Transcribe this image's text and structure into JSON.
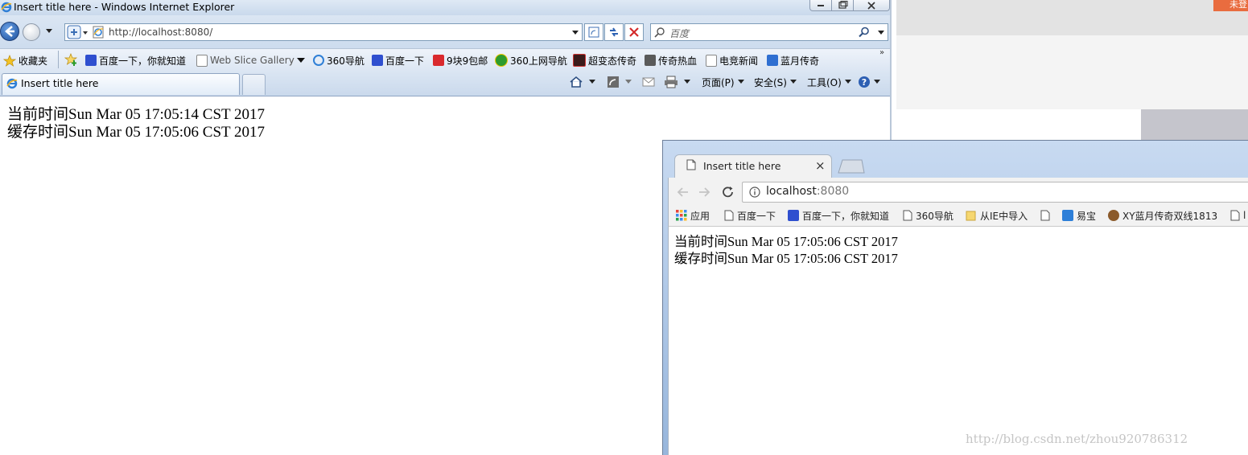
{
  "background": {
    "orange_button_label": "未登"
  },
  "ie": {
    "window_title": "Insert title here - Windows Internet Explorer",
    "address_url": "http://localhost:8080/",
    "search_placeholder": "百度",
    "favorites_label": "收藏夹",
    "favorites": [
      {
        "label": "百度一下，你就知道",
        "icon": "baidu-paw-icon"
      },
      {
        "label": "Web Slice Gallery",
        "icon": "ie-page-icon"
      },
      {
        "label": "360导航",
        "icon": "ie-logo-icon"
      },
      {
        "label": "百度一下",
        "icon": "baidu-paw-icon"
      },
      {
        "label": "9块9包邮",
        "icon": "red-square-icon"
      },
      {
        "label": "360上网导航",
        "icon": "360-icon"
      },
      {
        "label": "超变态传奇",
        "icon": "game-icon"
      },
      {
        "label": "传奇热血",
        "icon": "game-icon"
      },
      {
        "label": "电竞新闻",
        "icon": "ie-page-icon"
      },
      {
        "label": "蓝月传奇",
        "icon": "blue-grid-icon"
      }
    ],
    "tab_title": "Insert title here",
    "commands": {
      "page": "页面(P)",
      "safety": "安全(S)",
      "tools": "工具(O)"
    },
    "content": {
      "line1": "当前时间Sun Mar 05 17:05:14 CST 2017",
      "line2": "缓存时间Sun Mar 05 17:05:06 CST 2017"
    }
  },
  "chrome": {
    "tab_title": "Insert title here",
    "url_host": "localhost",
    "url_port": ":8080",
    "bookmarks": [
      {
        "label": "应用",
        "icon": "apps-grid-icon"
      },
      {
        "label": "百度一下",
        "icon": "page-icon"
      },
      {
        "label": "百度一下，你就知道",
        "icon": "baidu-paw-icon"
      },
      {
        "label": "360导航",
        "icon": "page-icon"
      },
      {
        "label": "从IE中导入",
        "icon": "folder-icon"
      },
      {
        "label": "",
        "icon": "page-icon"
      },
      {
        "label": "易宝",
        "icon": "blue-square-icon"
      },
      {
        "label": "XY蓝月传奇双线1813",
        "icon": "game-icon"
      },
      {
        "label": "l",
        "icon": "page-icon"
      }
    ],
    "content": {
      "line1": "当前时间Sun Mar 05 17:05:06 CST 2017",
      "line2": "缓存时间Sun Mar 05 17:05:06 CST 2017"
    }
  },
  "watermark": "http://blog.csdn.net/zhou920786312"
}
